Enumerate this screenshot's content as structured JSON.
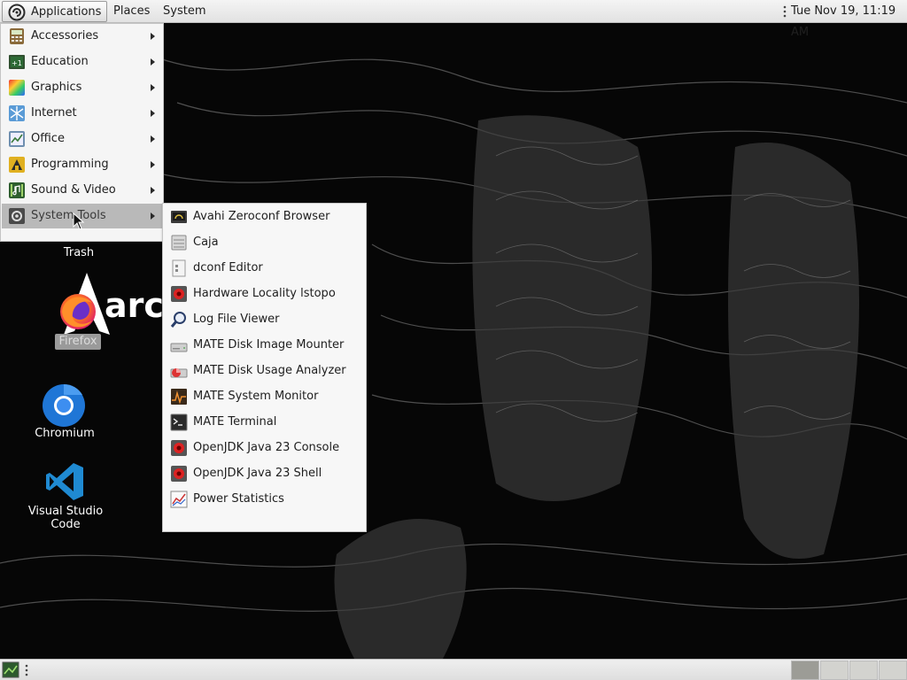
{
  "top_panel": {
    "menus": {
      "applications": "Applications",
      "places": "Places",
      "system": "System"
    },
    "clock": "Tue Nov 19, 11:19 AM"
  },
  "app_menu": {
    "items": [
      {
        "label": "Accessories",
        "icon": "accessories-icon"
      },
      {
        "label": "Education",
        "icon": "education-icon"
      },
      {
        "label": "Graphics",
        "icon": "graphics-icon"
      },
      {
        "label": "Internet",
        "icon": "internet-icon"
      },
      {
        "label": "Office",
        "icon": "office-icon"
      },
      {
        "label": "Programming",
        "icon": "programming-icon"
      },
      {
        "label": "Sound & Video",
        "icon": "sound-video-icon"
      },
      {
        "label": "System Tools",
        "icon": "system-tools-icon",
        "active": true
      }
    ]
  },
  "submenu": {
    "items": [
      {
        "label": "Avahi Zeroconf Browser",
        "icon": "avahi-icon"
      },
      {
        "label": "Caja",
        "icon": "file-manager-icon"
      },
      {
        "label": "dconf Editor",
        "icon": "dconf-icon"
      },
      {
        "label": "Hardware Locality lstopo",
        "icon": "java-app-icon"
      },
      {
        "label": "Log File Viewer",
        "icon": "magnifier-icon"
      },
      {
        "label": "MATE Disk Image Mounter",
        "icon": "disk-icon"
      },
      {
        "label": "MATE Disk Usage Analyzer",
        "icon": "disk-usage-icon"
      },
      {
        "label": "MATE System Monitor",
        "icon": "system-monitor-icon"
      },
      {
        "label": "MATE Terminal",
        "icon": "terminal-icon"
      },
      {
        "label": "OpenJDK Java 23 Console",
        "icon": "java-app-icon"
      },
      {
        "label": "OpenJDK Java 23 Shell",
        "icon": "java-app-icon"
      },
      {
        "label": "Power Statistics",
        "icon": "power-stats-icon"
      }
    ]
  },
  "desktop": {
    "trash": "Trash",
    "firefox": "Firefox",
    "chromium": "Chromium",
    "vscode": "Visual Studio Code"
  },
  "colors": {
    "panel_bg": "#e8e8e8",
    "menu_bg": "#f5f5f5",
    "active_item": "#b9b9b9",
    "desktop_bg": "#050505",
    "vscode_blue": "#1f8ad2",
    "firefox_orange": "#ff7a1a"
  }
}
